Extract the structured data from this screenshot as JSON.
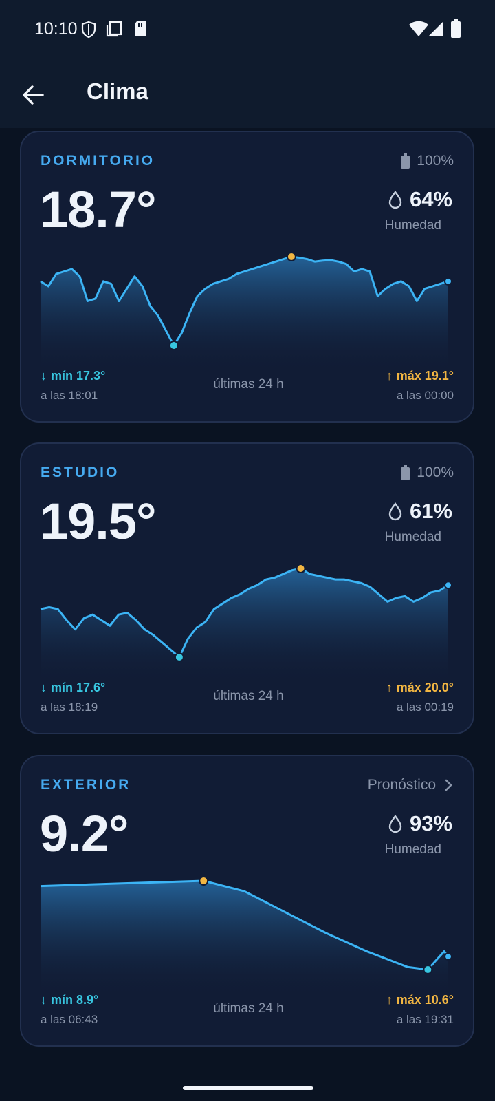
{
  "status_bar": {
    "time": "10:10",
    "left_icons": [
      "shield-icon",
      "screen-copy-icon",
      "sd-card-icon"
    ],
    "right_icons": [
      "wifi-icon",
      "signal-icon",
      "battery-icon"
    ]
  },
  "app_bar": {
    "title": "Clima",
    "back_icon": "arrow-left-icon"
  },
  "colors": {
    "accent": "#46aaf0",
    "line": "#3cb4f5",
    "min": "#38c6e0",
    "max": "#f2b642",
    "card": "#111c35"
  },
  "period_label": "últimas 24 h",
  "cards": [
    {
      "title": "DORMITORIO",
      "right_text": "100%",
      "right_icon": "battery-icon",
      "temperature": "18.7°",
      "humidity": "64%",
      "humidity_label": "Humedad",
      "min_label": "mín 17.3°",
      "min_time": "a las 18:01",
      "max_label": "máx 19.1°",
      "max_time": "a las 00:00",
      "series": [
        18.6,
        18.5,
        18.75,
        18.8,
        18.85,
        18.7,
        18.2,
        18.25,
        18.6,
        18.55,
        18.2,
        18.45,
        18.7,
        18.5,
        18.1,
        17.9,
        17.6,
        17.3,
        17.55,
        17.95,
        18.3,
        18.45,
        18.55,
        18.6,
        18.65,
        18.75,
        18.8,
        18.85,
        18.9,
        18.95,
        19.0,
        19.05,
        19.1,
        19.08,
        19.05,
        19.0,
        19.02,
        19.03,
        19.0,
        18.95,
        18.8,
        18.85,
        18.8,
        18.3,
        18.45,
        18.55,
        18.6,
        18.5,
        18.2,
        18.45,
        18.5,
        18.55,
        18.6
      ],
      "min_index": 17,
      "max_index": 32
    },
    {
      "title": "ESTUDIO",
      "right_text": "100%",
      "right_icon": "battery-icon",
      "temperature": "19.5°",
      "humidity": "61%",
      "humidity_label": "Humedad",
      "min_label": "mín 17.6°",
      "min_time": "a las 18:19",
      "max_label": "máx 20.0°",
      "max_time": "a las 00:19",
      "series": [
        18.9,
        18.95,
        18.9,
        18.6,
        18.35,
        18.65,
        18.75,
        18.6,
        18.45,
        18.75,
        18.8,
        18.6,
        18.35,
        18.2,
        18.0,
        17.8,
        17.6,
        18.1,
        18.4,
        18.55,
        18.9,
        19.05,
        19.2,
        19.3,
        19.45,
        19.55,
        19.7,
        19.75,
        19.85,
        19.95,
        20.0,
        19.85,
        19.8,
        19.75,
        19.7,
        19.7,
        19.65,
        19.6,
        19.5,
        19.3,
        19.1,
        19.2,
        19.25,
        19.1,
        19.2,
        19.35,
        19.4,
        19.55
      ],
      "min_index": 16,
      "max_index": 30
    },
    {
      "title": "EXTERIOR",
      "right_text": "Pronóstico",
      "right_icon": "chevron-right-icon",
      "temperature": "9.2°",
      "humidity": "93%",
      "humidity_label": "Humedad",
      "min_label": "mín 8.9°",
      "min_time": "a las 06:43",
      "max_label": "máx 10.6°",
      "max_time": "a las 19:31",
      "series": [
        10.5,
        10.55,
        10.6,
        10.4,
        10.0,
        9.6,
        9.25,
        8.95,
        8.9,
        9.25,
        9.15
      ],
      "x": [
        0,
        0.2,
        0.4,
        0.5,
        0.6,
        0.7,
        0.8,
        0.9,
        0.95,
        0.99,
        1.0
      ],
      "min_index": 8,
      "max_index": 2
    }
  ]
}
